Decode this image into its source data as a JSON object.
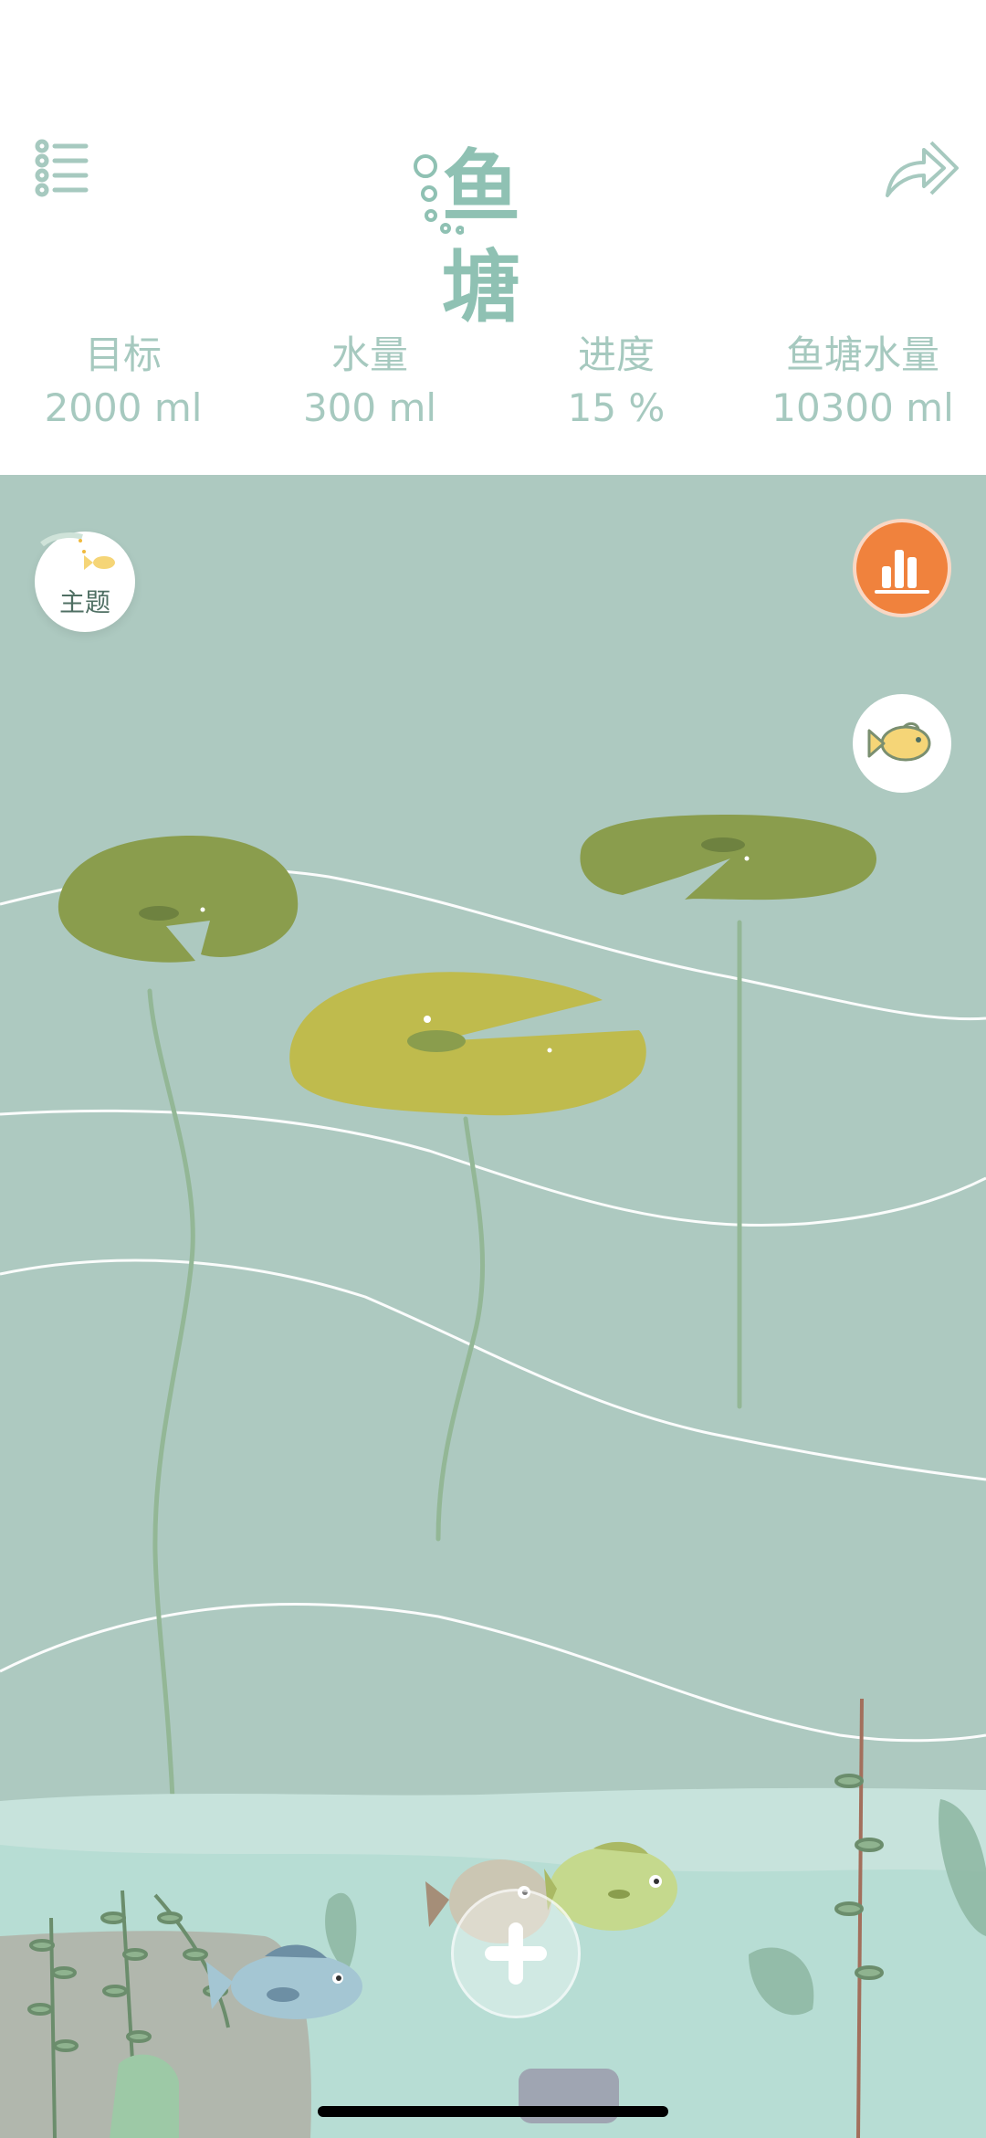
{
  "header": {
    "title": "鱼塘",
    "stats": [
      {
        "label": "目标",
        "value": "2000 ml"
      },
      {
        "label": "水量",
        "value": "300 ml"
      },
      {
        "label": "进度",
        "value": "15 %"
      },
      {
        "label": "鱼塘水量",
        "value": "10300 ml"
      }
    ]
  },
  "pond": {
    "theme_label": "主题"
  },
  "colors": {
    "accent_orange": "#f0823d",
    "text_green": "#a6c9bf",
    "pond_bg": "#adc9c0",
    "lily_dark": "#8a9d4d",
    "lily_light": "#bfbb4d"
  },
  "icons": {
    "menu": "list-menu-icon",
    "share": "share-arrow-icon",
    "stats": "bar-chart-icon",
    "fish": "fish-icon",
    "add": "plus-icon",
    "theme": "fishbowl-icon"
  }
}
